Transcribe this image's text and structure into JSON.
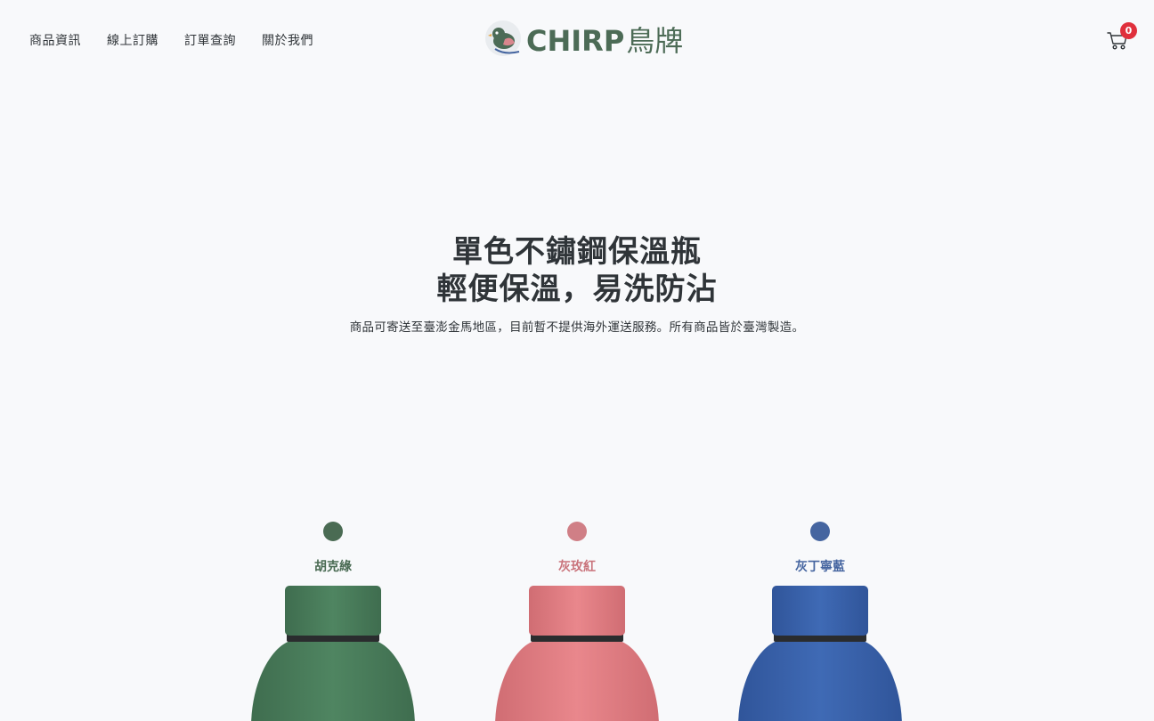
{
  "nav": {
    "items": [
      {
        "label": "商品資訊"
      },
      {
        "label": "線上訂購"
      },
      {
        "label": "訂單查詢"
      },
      {
        "label": "關於我們"
      }
    ]
  },
  "logo": {
    "text_latin": "CHIRP",
    "text_cjk": "鳥牌",
    "icon": "bird-icon",
    "color": "#4c6b56"
  },
  "cart": {
    "icon": "cart-icon",
    "count": "0",
    "badge_color": "#e0303c"
  },
  "hero": {
    "title_line1": "單色不鏽鋼保溫瓶",
    "title_line2": "輕便保溫，易洗防沾",
    "subtitle": "商品可寄送至臺澎金馬地區，目前暫不提供海外運送服務。所有商品皆於臺灣製造。"
  },
  "products": [
    {
      "name": "胡克綠",
      "swatch_color": "#4a6b53",
      "label_color": "#4a6b53",
      "bottle_color": "#4f8561",
      "bottle_dark": "#3f6d4f"
    },
    {
      "name": "灰玫紅",
      "swatch_color": "#d07f86",
      "label_color": "#c9737b",
      "bottle_color": "#e9878c",
      "bottle_dark": "#d06d73"
    },
    {
      "name": "灰丁寧藍",
      "swatch_color": "#4565a0",
      "label_color": "#4565a0",
      "bottle_color": "#3f6ab5",
      "bottle_dark": "#30559a"
    }
  ]
}
